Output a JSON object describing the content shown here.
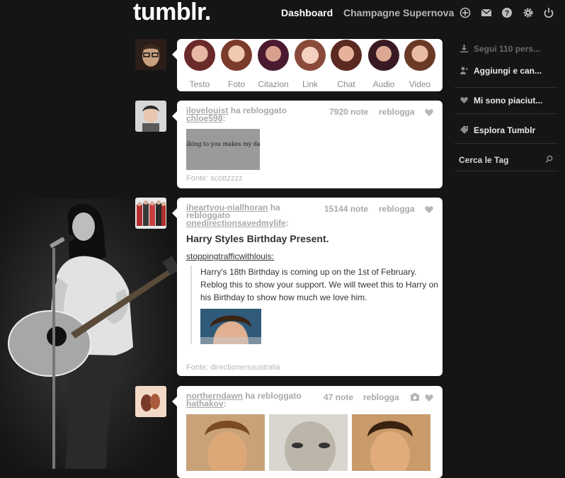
{
  "header": {
    "logo": "tumblr.",
    "nav_dashboard": "Dashboard",
    "nav_blog": "Champagne Supernova"
  },
  "post_types": [
    {
      "label": "Testo"
    },
    {
      "label": "Foto"
    },
    {
      "label": "Citazion"
    },
    {
      "label": "Link"
    },
    {
      "label": "Chat"
    },
    {
      "label": "Audio"
    },
    {
      "label": "Video"
    }
  ],
  "posts": [
    {
      "user": "ilovelouist",
      "action": "ha rebloggato",
      "source": "chloe598",
      "colon": ":",
      "notes": "7920 note",
      "reblog": "reblogga",
      "image_text": "talking to you makes my day.",
      "fonte": "Fonte: scottzzzz"
    },
    {
      "user": "iheartyou-niallhoran",
      "action": "ha",
      "action2": "rebloggato",
      "source": "onedirectionsavedmylife",
      "colon": ":",
      "notes": "15144 note",
      "reblog": "reblogga",
      "title": "Harry Styles Birthday Present.",
      "quoted_user": "stoppingtrafficwithlouis",
      "quoted_colon": ":",
      "quote": "Harry's 18th Birthday is coming up on the 1st of February. Reblog this to show your support. We will tweet this to Harry on his Birthday to show how much we love him.",
      "fonte": "Fonte: directionersaustralia"
    },
    {
      "user": "northerndawn",
      "action": "ha rebloggato",
      "source": "hathakov",
      "colon": ":",
      "notes": "47 note",
      "reblog": "reblogga"
    }
  ],
  "sidebar": {
    "following": "Segui 110 pers...",
    "add": "Aggiungi e can...",
    "liked": "Mi sono piaciut...",
    "explore": "Esplora Tumblr",
    "search_tag": "Cerca le Tag"
  },
  "colors": {
    "background": "#161515",
    "card": "#ffffff",
    "meta_text": "#a9a9a9"
  }
}
